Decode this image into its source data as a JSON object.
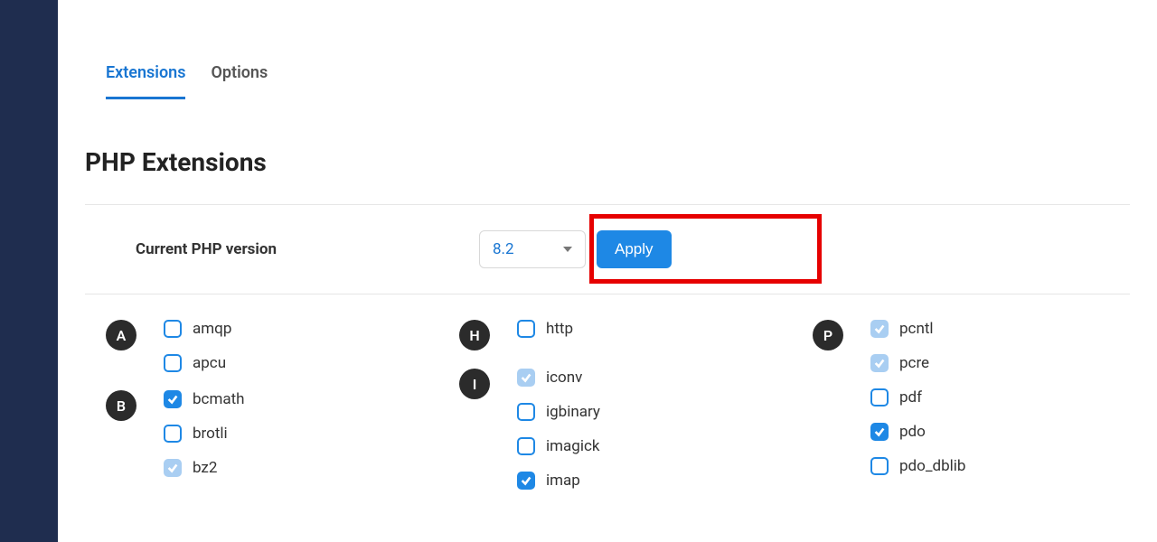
{
  "tabs": {
    "extensions": "Extensions",
    "options": "Options"
  },
  "section_title": "PHP Extensions",
  "version": {
    "label": "Current PHP version",
    "value": "8.2",
    "apply": "Apply"
  },
  "letters": {
    "a": "A",
    "b": "B",
    "h": "H",
    "i": "I",
    "p": "P"
  },
  "ext": {
    "amqp": "amqp",
    "apcu": "apcu",
    "bcmath": "bcmath",
    "brotli": "brotli",
    "bz2": "bz2",
    "http": "http",
    "iconv": "iconv",
    "igbinary": "igbinary",
    "imagick": "imagick",
    "imap": "imap",
    "pcntl": "pcntl",
    "pcre": "pcre",
    "pdf": "pdf",
    "pdo": "pdo",
    "pdo_dblib": "pdo_dblib"
  }
}
